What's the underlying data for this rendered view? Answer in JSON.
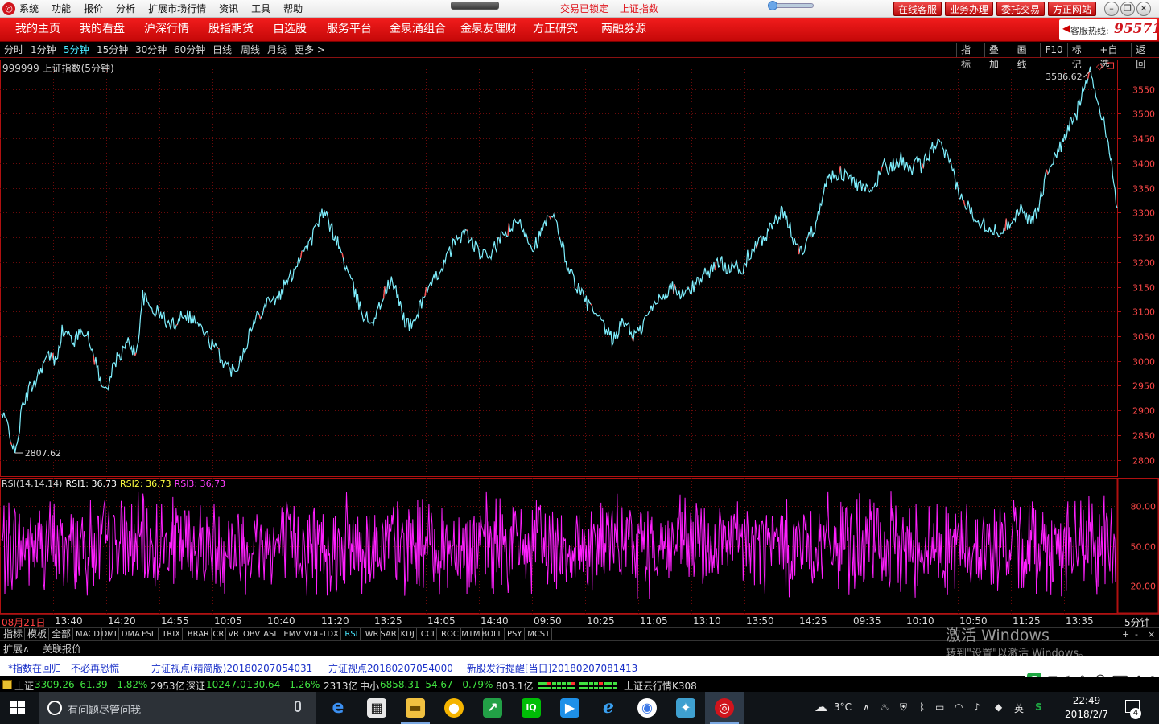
{
  "titlebar": {
    "menu": [
      "系统",
      "功能",
      "报价",
      "分析",
      "扩展市场行情",
      "资讯",
      "工具",
      "帮助"
    ],
    "status_lock": "交易已锁定",
    "status_index": "上证指数",
    "buttons": [
      "在线客服",
      "业务办理",
      "委托交易",
      "方正网站"
    ]
  },
  "nav": {
    "items": [
      "我的主页",
      "我的看盘",
      "沪深行情",
      "股指期货",
      "自选股",
      "服务平台",
      "金泉涌组合",
      "金泉友理财",
      "方正研究",
      "两融券源"
    ],
    "hotline_label": "客服热线:",
    "hotline_number": "95571"
  },
  "period_bar": {
    "periods": [
      "分时",
      "1分钟",
      "5分钟",
      "15分钟",
      "30分钟",
      "60分钟",
      "日线",
      "周线",
      "月线",
      "更多 >"
    ],
    "active_index": 2,
    "tools": [
      "指标",
      "叠加",
      "画线",
      "F10",
      "标记",
      "+自选",
      "返回"
    ]
  },
  "chart_title": "999999 上证指数(5分钟)",
  "colors": {
    "price_line": "#7ff0ff",
    "price_up_tint": "#ff5050",
    "rsi": "#ff20ff",
    "grid": "#6a0a0a",
    "axis_border": "#b01010",
    "axis_text": "#ff4848"
  },
  "chart_data": [
    {
      "type": "line",
      "title": "999999 上证指数(5分钟)",
      "ylim": [
        2780,
        3590
      ],
      "yticks": [
        2800,
        2850,
        2900,
        2950,
        3000,
        3050,
        3100,
        3150,
        3200,
        3250,
        3300,
        3350,
        3400,
        3450,
        3500,
        3550
      ],
      "high_label": "3586.62",
      "low_label": "2807.62",
      "x_labels": [
        "08月21日",
        "13:40",
        "14:20",
        "14:55",
        "10:05",
        "10:40",
        "11:20",
        "13:25",
        "14:05",
        "14:40",
        "09:50",
        "10:25",
        "11:05",
        "13:10",
        "13:50",
        "14:25",
        "09:35",
        "10:10",
        "10:50",
        "11:25",
        "13:35"
      ],
      "series": [
        {
          "values": [
            2890,
            2870,
            2807.62,
            2900,
            2940,
            2960,
            2990,
            3010,
            3000,
            3060,
            3050,
            3040,
            3070,
            3040,
            3000,
            2940,
            2960,
            3000,
            3020,
            3040,
            3010,
            3130,
            3110,
            3100,
            3090,
            3070,
            3080,
            3100,
            3090,
            3080,
            3060,
            3040,
            3020,
            3000,
            2980,
            2990,
            3020,
            3060,
            3090,
            3110,
            3130,
            3120,
            3150,
            3170,
            3200,
            3230,
            3240,
            3280,
            3300,
            3270,
            3240,
            3200,
            3160,
            3120,
            3090,
            3080,
            3100,
            3140,
            3160,
            3130,
            3080,
            3070,
            3100,
            3140,
            3150,
            3180,
            3200,
            3230,
            3250,
            3260,
            3240,
            3220,
            3210,
            3220,
            3240,
            3260,
            3270,
            3280,
            3260,
            3230,
            3250,
            3280,
            3290,
            3260,
            3200,
            3170,
            3140,
            3120,
            3100,
            3080,
            3060,
            3040,
            3070,
            3080,
            3050,
            3060,
            3090,
            3110,
            3130,
            3140,
            3150,
            3130,
            3140,
            3150,
            3170,
            3180,
            3190,
            3200,
            3190,
            3200,
            3170,
            3210,
            3230,
            3240,
            3260,
            3280,
            3300,
            3280,
            3240,
            3220,
            3250,
            3270,
            3330,
            3370,
            3380,
            3380,
            3370,
            3360,
            3350,
            3340,
            3350,
            3400,
            3390,
            3400,
            3410,
            3380,
            3400,
            3390,
            3420,
            3440,
            3430,
            3400,
            3360,
            3320,
            3310,
            3290,
            3280,
            3270,
            3260,
            3270,
            3280,
            3300,
            3310,
            3280,
            3300,
            3350,
            3400,
            3420,
            3440,
            3480,
            3500,
            3560,
            3586.62,
            3530,
            3480,
            3420,
            3310
          ],
          "color": "#7ff0ff"
        }
      ]
    },
    {
      "type": "line",
      "title": "RSI(14,14,14)",
      "ylim": [
        0,
        100
      ],
      "yticks": [
        20,
        50,
        80
      ],
      "legend": [
        {
          "label": "RSI(14,14,14)",
          "color": "#d8d8d8"
        },
        {
          "label": "RSI1: 36.73",
          "color": "#ffffff"
        },
        {
          "label": "RSI2: 36.73",
          "color": "#ffff40"
        },
        {
          "label": "RSI3: 36.73",
          "color": "#ff40ff"
        }
      ],
      "series": [
        {
          "name": "RSI3",
          "range": [
            10,
            92
          ],
          "color": "#ff20ff"
        }
      ]
    }
  ],
  "time_axis_period": "5分钟",
  "indicator_tabs": {
    "items": [
      "指标",
      "模板",
      "全部",
      "MACD",
      "DMI",
      "DMA",
      "FSL",
      "TRIX",
      "BRAR",
      "CR",
      "VR",
      "OBV",
      "ASI",
      "EMV",
      "VOL-TDX",
      "RSI",
      "WR",
      "SAR",
      "KDJ",
      "CCI",
      "ROC",
      "MTM",
      "BOLL",
      "PSY",
      "MCST"
    ],
    "active": "RSI",
    "plus": "+",
    "minus": "-",
    "times": "×"
  },
  "ext_bar": {
    "expand": "扩展∧",
    "linked": "关联报价"
  },
  "watermark": {
    "line1": "激活 Windows",
    "line2": "转到\"设置\"以激活 Windows。"
  },
  "news": [
    "*指数在回归　不必再恐慌",
    "方证视点(精简版)20180207054031",
    "方证视点20180207054000",
    "新股发行提醒[当日]20180207081413"
  ],
  "quotes": {
    "sh": {
      "name": "上证",
      "value": "3309.26",
      "change": "-61.39",
      "pct": "-1.82%",
      "vol": "2953亿"
    },
    "sz": {
      "name": "深证",
      "value": "10247.0",
      "change": "-130.64",
      "pct": "-1.26%",
      "vol": "2313亿"
    },
    "zx": {
      "name": "中小",
      "value": "6858.31",
      "change": "-54.67",
      "pct": "-0.79%",
      "vol": "803.1亿"
    },
    "cloud": "上证云行情K308"
  },
  "ime": {
    "mode": "五"
  },
  "taskbar": {
    "search_placeholder": "有问题尽管问我",
    "weather": "3°C",
    "lang": "英",
    "time": "22:49",
    "date": "2018/2/7",
    "notifications": "4"
  }
}
